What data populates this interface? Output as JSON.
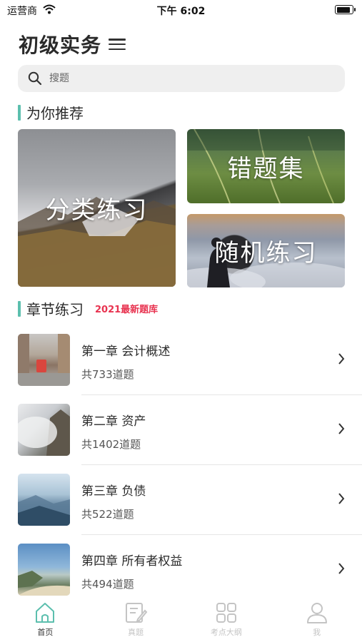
{
  "status_bar": {
    "carrier": "运营商",
    "time": "下午 6:02",
    "battery_level": 0.9
  },
  "header": {
    "title": "初级实务",
    "menu_icon": "menu-icon"
  },
  "search": {
    "placeholder": "搜题",
    "value": "",
    "icon": "search-icon"
  },
  "recommend": {
    "title": "为你推荐",
    "cards": [
      {
        "label": "分类练习"
      },
      {
        "label": "错题集"
      },
      {
        "label": "随机练习"
      }
    ]
  },
  "chapters": {
    "title": "章节练习",
    "badge": "2021最新题库",
    "items": [
      {
        "title": "第一章 会计概述",
        "count": "共733道题"
      },
      {
        "title": "第二章 资产",
        "count": "共1402道题"
      },
      {
        "title": "第三章 负债",
        "count": "共522道题"
      },
      {
        "title": "第四章 所有者权益",
        "count": "共494道题"
      }
    ]
  },
  "tab_bar": {
    "tabs": [
      {
        "label": "首页",
        "icon": "home-icon",
        "active": true
      },
      {
        "label": "真题",
        "icon": "exam-edit-icon",
        "active": false
      },
      {
        "label": "考点大纲",
        "icon": "grid-icon",
        "active": false
      },
      {
        "label": "我",
        "icon": "user-icon",
        "active": false
      }
    ]
  },
  "colors": {
    "accent": "#5cbfae",
    "badge": "#e83350",
    "tab_active": "#5cbfae",
    "tab_inactive": "#c4c4c4"
  }
}
